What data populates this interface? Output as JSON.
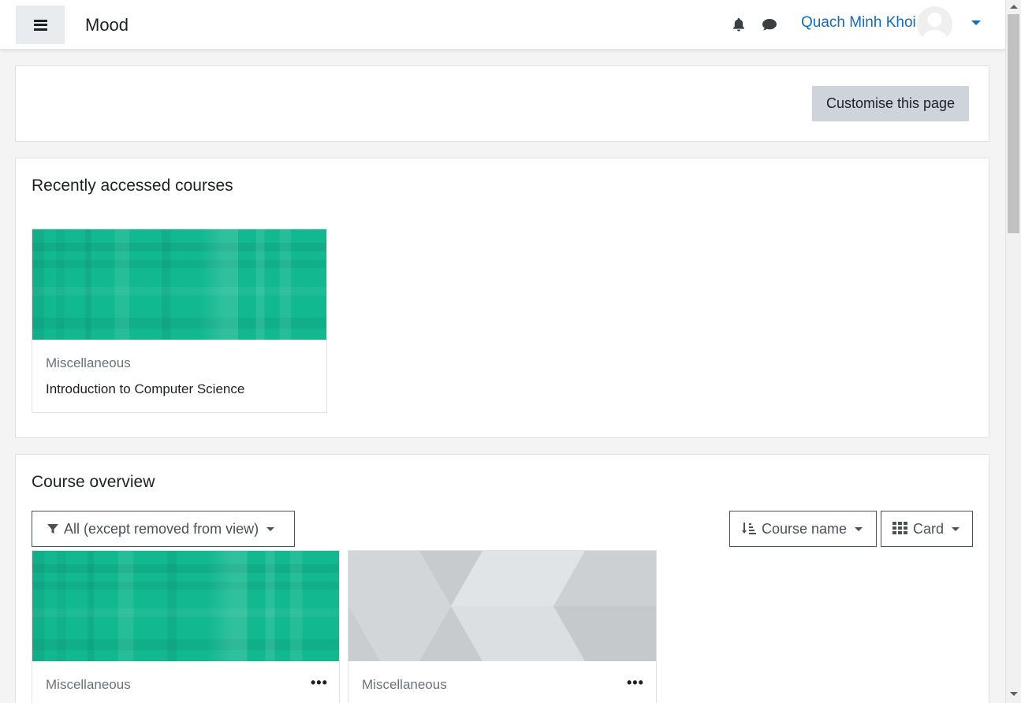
{
  "navbar": {
    "brand": "Mood",
    "user_name": "Quach Minh Khoi",
    "icons": [
      "hamburger-icon",
      "bell-icon",
      "chat-icon",
      "chevron-down-icon"
    ]
  },
  "top_block": {
    "customise_label": "Customise this page"
  },
  "recent": {
    "title": "Recently accessed courses",
    "courses": [
      {
        "category": "Miscellaneous",
        "name": "Introduction to Computer Science"
      }
    ]
  },
  "overview": {
    "title": "Course overview",
    "filter_label": "All (except removed from view)",
    "sort_label": "Course name",
    "view_label": "Card",
    "courses": [
      {
        "category": "Miscellaneous",
        "more": "•••"
      },
      {
        "category": "Miscellaneous",
        "more": "•••"
      }
    ]
  },
  "colors": {
    "link": "#0f6cbf",
    "course_green": "#12b890",
    "course_grey": "#d5d8dc"
  }
}
